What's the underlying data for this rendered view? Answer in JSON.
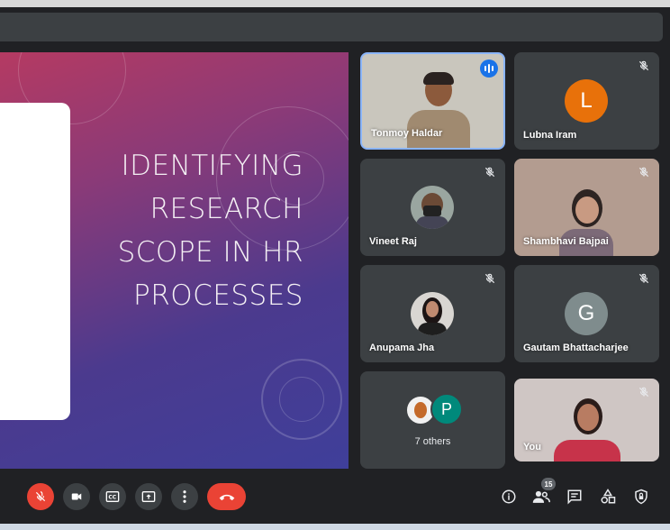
{
  "slide": {
    "title_lines": [
      "IDENTIFYING",
      "RESEARCH",
      "SCOPE IN HR",
      "PROCESSES"
    ]
  },
  "participants": [
    {
      "name": "Tonmoy Haldar",
      "type": "video",
      "speaking": true
    },
    {
      "name": "Lubna Iram",
      "type": "initial",
      "initial": "L",
      "color": "#e8710a",
      "muted": true
    },
    {
      "name": "Vineet Raj",
      "type": "photo",
      "muted": true
    },
    {
      "name": "Shambhavi Bajpai",
      "type": "video",
      "muted": true
    },
    {
      "name": "Anupama Jha",
      "type": "photo",
      "muted": true
    },
    {
      "name": "Gautam Bhattacharjee",
      "type": "initial",
      "initial": "G",
      "color": "#7f8c8d",
      "muted": true
    },
    {
      "name": "You",
      "type": "video",
      "muted": true
    }
  ],
  "others": {
    "label": "7 others",
    "initial": "P",
    "color": "#00897b"
  },
  "controls": {
    "people_count": "15"
  },
  "colors": {
    "accent": "#1a73e8",
    "danger": "#ea4335",
    "tile": "#3c4043",
    "background": "#202124"
  },
  "icons": [
    "mic-off-icon",
    "camera-icon",
    "captions-icon",
    "present-icon",
    "more-icon",
    "end-call-icon",
    "info-icon",
    "people-icon",
    "chat-icon",
    "activities-icon",
    "host-controls-icon"
  ]
}
